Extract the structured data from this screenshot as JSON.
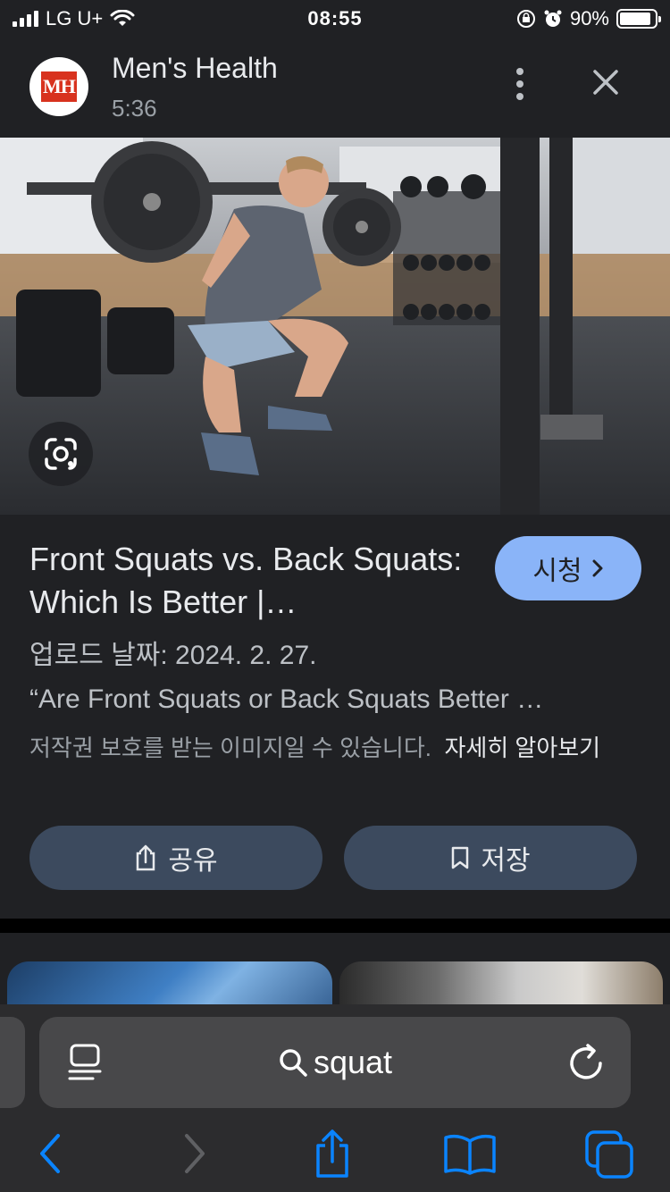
{
  "status_bar": {
    "carrier": "LG U+",
    "time": "08:55",
    "battery": "90%",
    "battery_level": 0.9
  },
  "header": {
    "logo_text": "MH",
    "source_name": "Men's Health",
    "duration": "5:36",
    "icons": {
      "more": "more-vert-icon",
      "close": "close-icon"
    }
  },
  "hero": {
    "lens_icon": "google-lens-icon"
  },
  "details": {
    "title": "Front Squats vs. Back Squats: Which Is Better |…",
    "watch_label": "시청",
    "upload_date": "업로드 날짜: 2024. 2. 27.",
    "snippet": "“Are Front Squats or Back Squats Better …",
    "copyright_text": "저작권 보호를 받는 이미지일 수 있습니다.",
    "learn_more": "자세히 알아보기",
    "share_label": "공유",
    "save_label": "저장"
  },
  "safari": {
    "query": "squat",
    "icons": {
      "reader": "reader-icon",
      "search": "search-icon",
      "reload": "reload-icon",
      "back": "back-icon",
      "forward": "forward-icon",
      "share": "share-icon",
      "bookmarks": "bookmarks-icon",
      "tabs": "tabs-icon"
    }
  },
  "colors": {
    "background": "#202124",
    "accent": "#8ab4f8",
    "button": "#3c4a5e",
    "ios_blue": "#0a84ff"
  }
}
